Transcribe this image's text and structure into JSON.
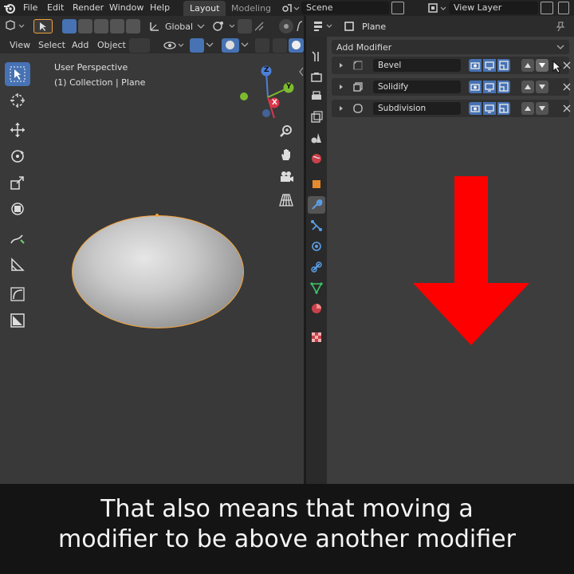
{
  "menubar": {
    "items": [
      "File",
      "Edit",
      "Render",
      "Window",
      "Help"
    ],
    "workspace_tabs": [
      {
        "label": "Layout",
        "active": true
      },
      {
        "label": "Modeling",
        "active": false
      }
    ],
    "scene": "Scene",
    "view_layer": "View Layer"
  },
  "viewport": {
    "menu": [
      "View",
      "Select",
      "Add",
      "Object"
    ],
    "transform_orientation": "Global",
    "overlay_title": "User Perspective",
    "overlay_subtitle": "(1) Collection | Plane",
    "gizmo": {
      "x": "X",
      "y": "Y",
      "z": "Z"
    }
  },
  "properties": {
    "object_name": "Plane",
    "add_modifier_label": "Add Modifier",
    "modifiers": [
      {
        "name": "Bevel",
        "icon": "bevel-icon"
      },
      {
        "name": "Solidify",
        "icon": "solidify-icon"
      },
      {
        "name": "Subdivision",
        "icon": "subdivision-icon"
      }
    ]
  },
  "colors": {
    "accent": "#4772b3",
    "selection_outline": "#f3a33c",
    "arrow": "#ff0000"
  },
  "caption": {
    "line1": "That also means that moving a",
    "line2": "modifier to be above another modifier"
  }
}
